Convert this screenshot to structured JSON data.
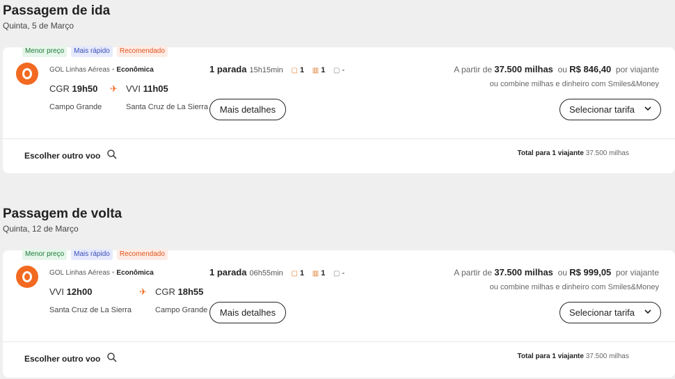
{
  "outbound": {
    "title": "Passagem de ida",
    "date": "Quinta, 5 de Março",
    "badges": [
      "Menor preço",
      "Mais rápido",
      "Recomendado"
    ],
    "airline": "GOL Linhas Aéreas",
    "cabin": "Econômica",
    "dep_code": "CGR",
    "dep_time": "19h50",
    "arr_code": "VVI",
    "arr_time": "11h05",
    "dep_city": "Campo Grande",
    "arr_city": "Santa Cruz de La Sierra",
    "stops": "1 parada",
    "duration": "15h15min",
    "bag1": "1",
    "bag2": "1",
    "bag3": "-",
    "details_label": "Mais detalhes",
    "price_prefix": "A partir de",
    "miles": "37.500 milhas",
    "or": "ou",
    "money": "R$ 846,40",
    "per": "por viajante",
    "combine": "ou combine milhas e dinheiro com Smiles&Money",
    "select_label": "Selecionar tarifa",
    "other_label": "Escolher outro voo",
    "total_label": "Total para 1 viajante",
    "total_value": "37.500 milhas"
  },
  "inbound": {
    "title": "Passagem de volta",
    "date": "Quinta, 12 de Março",
    "badges": [
      "Menor preço",
      "Mais rápido",
      "Recomendado"
    ],
    "airline": "GOL Linhas Aéreas",
    "cabin": "Econômica",
    "dep_code": "VVI",
    "dep_time": "12h00",
    "arr_code": "CGR",
    "arr_time": "18h55",
    "dep_city": "Santa Cruz de La Sierra",
    "arr_city": "Campo Grande",
    "stops": "1 parada",
    "duration": "06h55min",
    "bag1": "1",
    "bag2": "1",
    "bag3": "-",
    "details_label": "Mais detalhes",
    "price_prefix": "A partir de",
    "miles": "37.500 milhas",
    "or": "ou",
    "money": "R$ 999,05",
    "per": "por viajante",
    "combine": "ou combine milhas e dinheiro com Smiles&Money",
    "select_label": "Selecionar tarifa",
    "other_label": "Escolher outro voo",
    "total_label": "Total para 1 viajante",
    "total_value": "37.500 milhas"
  },
  "icons": {
    "plane": "✈",
    "search": "⚲",
    "chevron": "⌄",
    "bag": "🛄"
  },
  "colors": {
    "accent": "#f26a21"
  }
}
